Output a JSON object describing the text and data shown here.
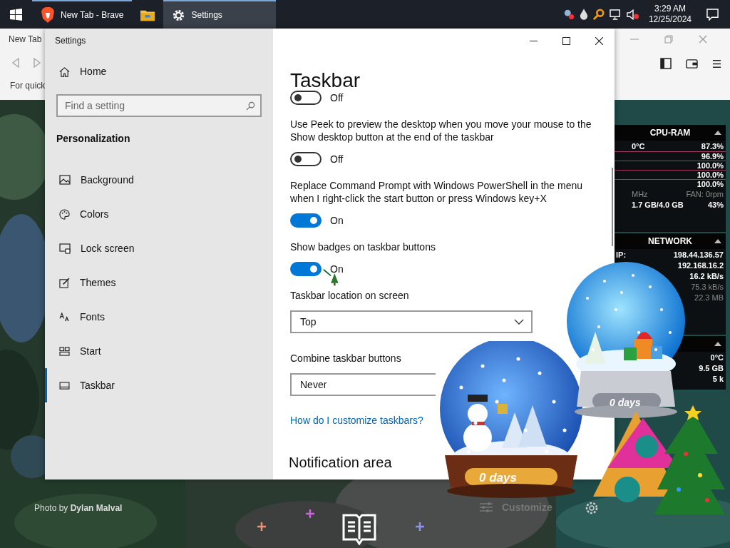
{
  "taskbar": {
    "apps": [
      {
        "kind": "browser",
        "label": "New Tab - Brave",
        "selected": false
      },
      {
        "kind": "folder",
        "selected": false
      },
      {
        "kind": "settings",
        "label": "Settings",
        "selected": true
      }
    ],
    "time": "3:29 AM",
    "date": "12/25/2024"
  },
  "browser": {
    "tab": "New Tab",
    "hint": "For quick",
    "photo_credit": "Photo by **Dylan Malval**",
    "customize": "Customize"
  },
  "cpu_panel": {
    "title": "CPU-RAM",
    "temp": "0°C",
    "cores": [
      "87.3%",
      "96.9%",
      "100.0%",
      "100.0%",
      "100.0%"
    ],
    "freq": "MHz",
    "fan": "FAN: 0rpm",
    "memory": "1.7 GB/4.0 GB",
    "memory_percent": "43%"
  },
  "network_panel": {
    "title": "NETWORK",
    "ip_label": "IP:",
    "values": [
      "198.44.136.57",
      "192.168.16.2",
      "16.2 kB/s",
      "75.3 kB/s",
      "22.3 MB"
    ]
  },
  "third_panel": {
    "values": [
      "0°C",
      "9.5 GB",
      "5 k"
    ]
  },
  "globes": [
    {
      "caption": "0 days"
    },
    {
      "caption": "0 days"
    }
  ],
  "settings": {
    "title": "Settings",
    "home": "Home",
    "search_placeholder": "Find a setting",
    "section": "Personalization",
    "nav": [
      {
        "label": "Background",
        "selected": false
      },
      {
        "label": "Colors",
        "selected": false
      },
      {
        "label": "Lock screen",
        "selected": false
      },
      {
        "label": "Themes",
        "selected": false
      },
      {
        "label": "Fonts",
        "selected": false
      },
      {
        "label": "Start",
        "selected": false
      },
      {
        "label": "Taskbar",
        "selected": true
      }
    ],
    "page_title": "Taskbar",
    "items": [
      {
        "kind": "toggle",
        "on": false,
        "state_text": "Off"
      },
      {
        "kind": "toggle",
        "label": "Use Peek to preview the desktop when you move your mouse to the Show desktop button at the end of the taskbar",
        "on": false,
        "state_text": "Off"
      },
      {
        "kind": "toggle",
        "label": "Replace Command Prompt with Windows PowerShell in the menu when I right-click the start button or press Windows key+X",
        "on": true,
        "state_text": "On"
      },
      {
        "kind": "toggle",
        "label": "Show badges on taskbar buttons",
        "on": true,
        "state_text": "On"
      },
      {
        "kind": "dropdown",
        "label": "Taskbar location on screen",
        "value": "Top"
      },
      {
        "kind": "dropdown",
        "label": "Combine taskbar buttons",
        "value": "Never",
        "partly_hidden": true
      },
      {
        "kind": "link",
        "label": "How do I customize taskbars?"
      },
      {
        "kind": "heading",
        "label": "Notification area"
      }
    ]
  }
}
